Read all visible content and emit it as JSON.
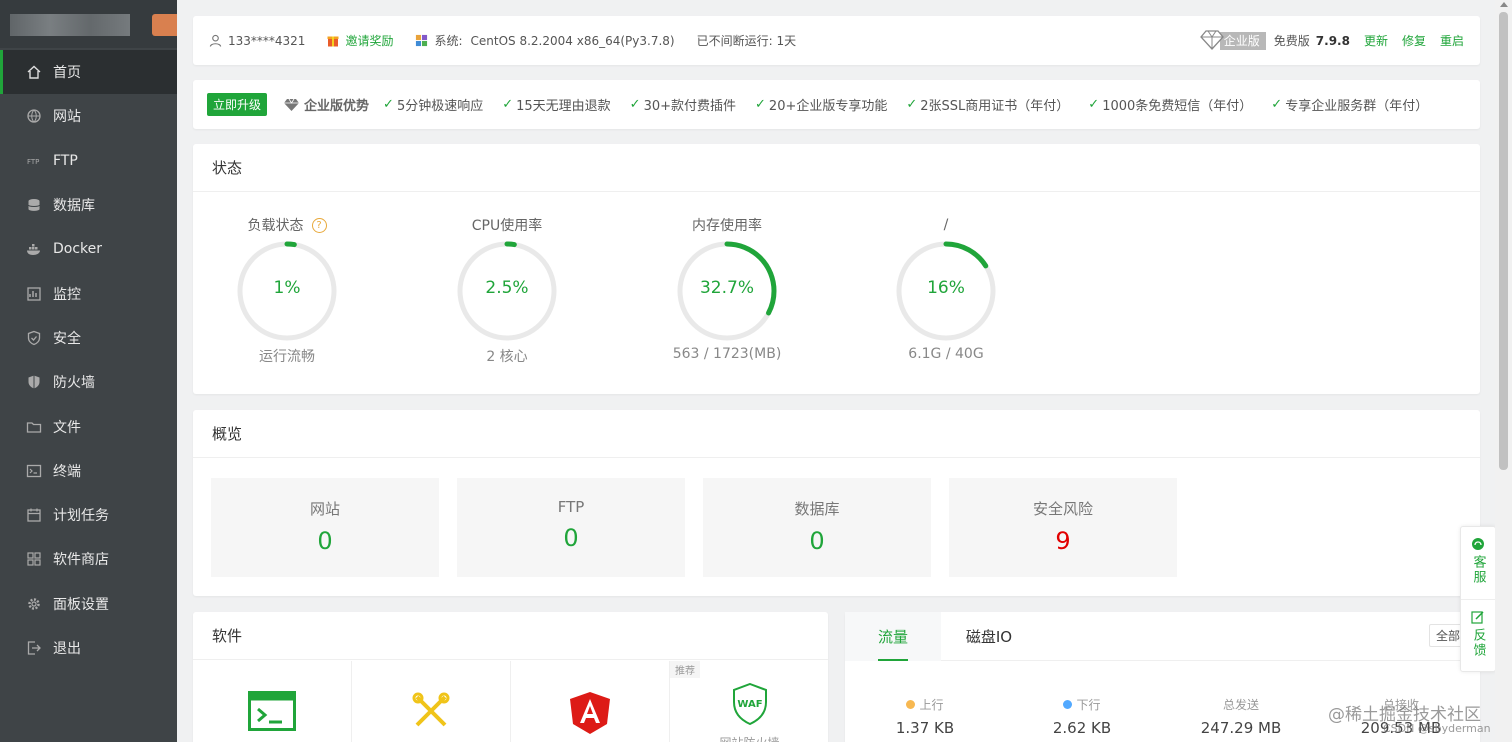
{
  "sidebar": {
    "items": [
      {
        "label": "首页",
        "icon": "home-icon"
      },
      {
        "label": "网站",
        "icon": "globe-icon"
      },
      {
        "label": "FTP",
        "icon": "ftp-icon"
      },
      {
        "label": "数据库",
        "icon": "database-icon"
      },
      {
        "label": "Docker",
        "icon": "docker-icon"
      },
      {
        "label": "监控",
        "icon": "monitor-icon"
      },
      {
        "label": "安全",
        "icon": "shield-check-icon"
      },
      {
        "label": "防火墙",
        "icon": "firewall-icon"
      },
      {
        "label": "文件",
        "icon": "folder-icon"
      },
      {
        "label": "终端",
        "icon": "terminal-icon"
      },
      {
        "label": "计划任务",
        "icon": "calendar-icon"
      },
      {
        "label": "软件商店",
        "icon": "grid-icon"
      },
      {
        "label": "面板设置",
        "icon": "gear-icon"
      },
      {
        "label": "退出",
        "icon": "logout-icon"
      }
    ]
  },
  "topbar": {
    "user": "133****4321",
    "invite": "邀请奖励",
    "system_label": "系统:",
    "system_value": "CentOS 8.2.2004 x86_64(Py3.7.8)",
    "uptime": "已不间断运行: 1天",
    "edition_badge": "企业版",
    "free_label": "免费版",
    "version": "7.9.8",
    "update": "更新",
    "repair": "修复",
    "restart": "重启"
  },
  "promo": {
    "upgrade": "立即升级",
    "advantage": "企业版优势",
    "features": [
      "5分钟极速响应",
      "15天无理由退款",
      "30+款付费插件",
      "20+企业版专享功能",
      "2张SSL商用证书（年付）",
      "1000条免费短信（年付）",
      "专享企业服务群（年付）"
    ]
  },
  "status": {
    "title": "状态",
    "gauges": [
      {
        "title": "负载状态",
        "value": "1%",
        "percent": 1,
        "sub": "运行流畅",
        "help": "?"
      },
      {
        "title": "CPU使用率",
        "value": "2.5%",
        "percent": 2.5,
        "sub": "2 核心"
      },
      {
        "title": "内存使用率",
        "value": "32.7%",
        "percent": 32.7,
        "sub": "563 / 1723(MB)"
      },
      {
        "title": "/",
        "value": "16%",
        "percent": 16,
        "sub": "6.1G / 40G"
      }
    ]
  },
  "overview": {
    "title": "概览",
    "boxes": [
      {
        "label": "网站",
        "value": "0"
      },
      {
        "label": "FTP",
        "value": "0"
      },
      {
        "label": "数据库",
        "value": "0"
      },
      {
        "label": "安全风险",
        "value": "9"
      }
    ]
  },
  "software": {
    "title": "软件",
    "recommend_tag": "推荐",
    "waf_label": "网站防火墙"
  },
  "traffic": {
    "tabs": [
      "流量",
      "磁盘IO"
    ],
    "all": "全部",
    "stats": [
      {
        "label": "上行",
        "value": "1.37 KB",
        "dot": "#f7b851"
      },
      {
        "label": "下行",
        "value": "2.62 KB",
        "dot": "#52a9ff"
      },
      {
        "label": "总发送",
        "value": "247.29 MB"
      },
      {
        "label": "总接收",
        "value": "209.53 MB"
      }
    ]
  },
  "float_help": {
    "service": "客服",
    "feedback": "反馈"
  },
  "watermark": {
    "main": "@稀土掘金技术社区",
    "sub": "CSDN @sbyderman"
  },
  "colors": {
    "accent": "#20a53a",
    "danger": "#e20000",
    "sidebar": "#3f4447"
  }
}
